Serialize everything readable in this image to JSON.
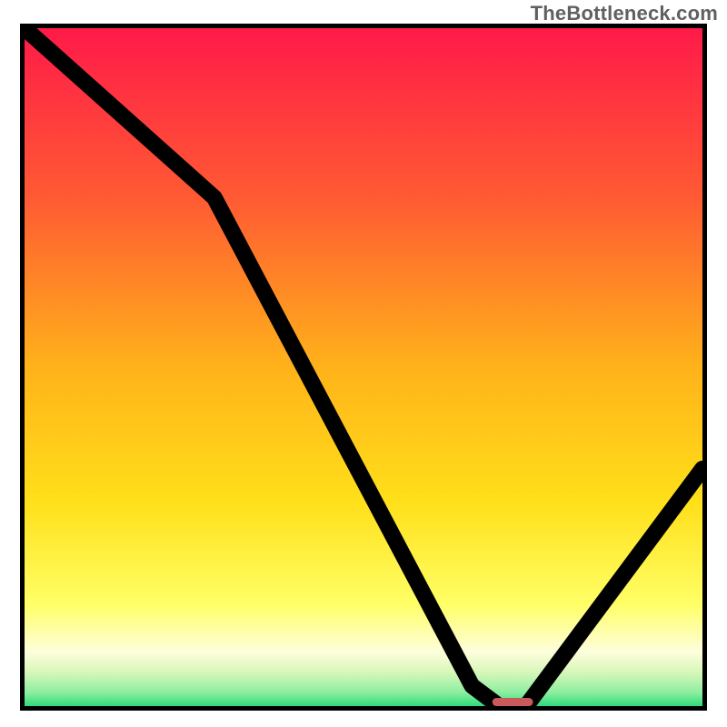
{
  "attribution": "TheBottleneck.com",
  "chart_data": {
    "type": "line",
    "title": "",
    "xlabel": "",
    "ylabel": "",
    "xlim": [
      0,
      100
    ],
    "ylim": [
      0,
      100
    ],
    "x": [
      0,
      28,
      66,
      70,
      74,
      100
    ],
    "values": [
      100,
      75,
      3,
      0,
      0,
      35
    ],
    "marker": {
      "x": 72,
      "y": 0,
      "w": 6,
      "h": 1.2
    },
    "gradient_stops": [
      {
        "offset": 0,
        "color": "#ff1a49"
      },
      {
        "offset": 25,
        "color": "#ff5a33"
      },
      {
        "offset": 50,
        "color": "#ffb21a"
      },
      {
        "offset": 70,
        "color": "#ffe01a"
      },
      {
        "offset": 85,
        "color": "#ffff66"
      },
      {
        "offset": 92,
        "color": "#fdfedc"
      },
      {
        "offset": 95,
        "color": "#d8f7ba"
      },
      {
        "offset": 98,
        "color": "#8ceea0"
      },
      {
        "offset": 100,
        "color": "#2edb7a"
      }
    ]
  }
}
